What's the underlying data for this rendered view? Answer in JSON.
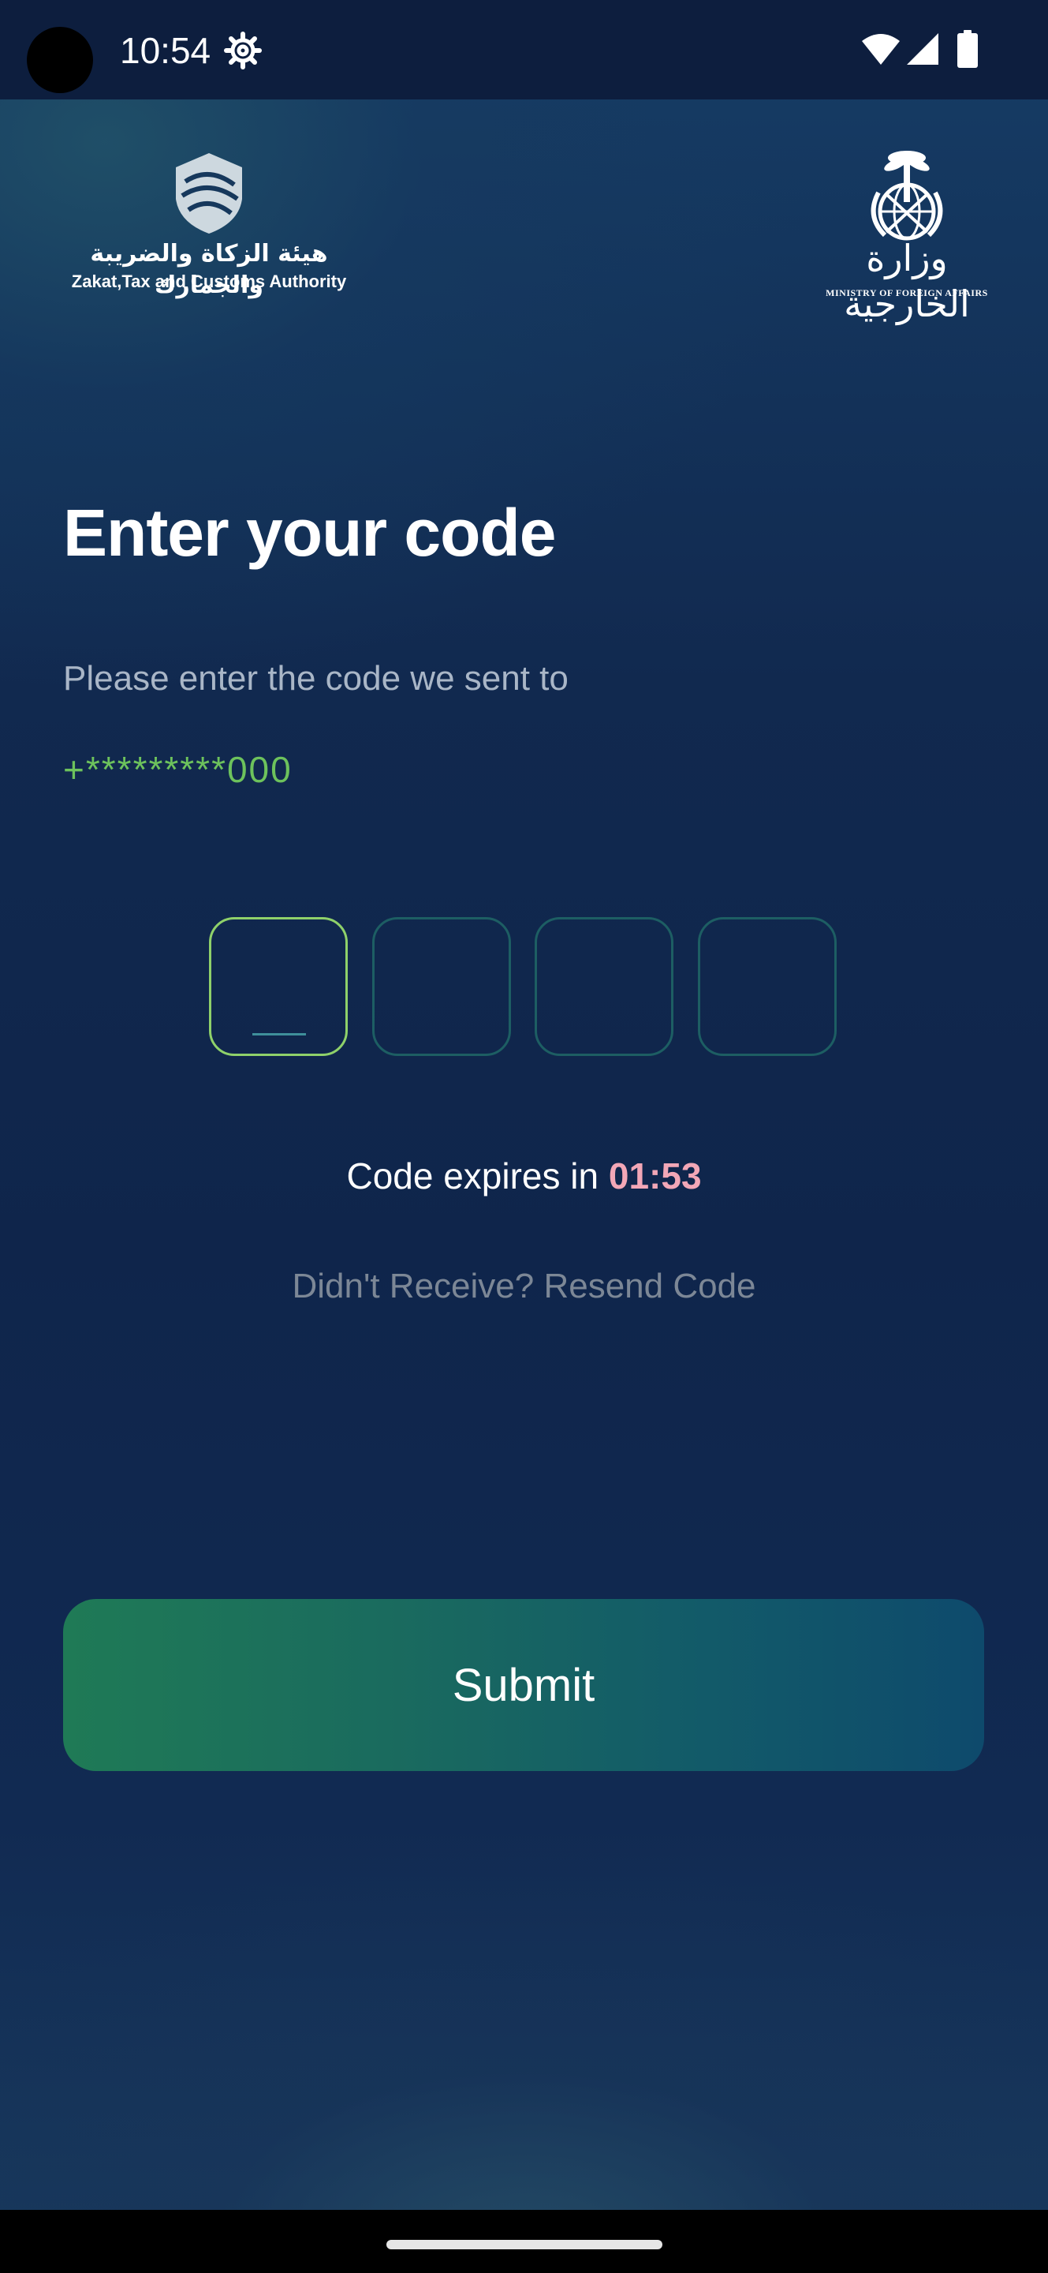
{
  "status_bar": {
    "time": "10:54",
    "icons": [
      "settings-icon",
      "wifi-icon",
      "cell-signal-icon",
      "battery-icon"
    ]
  },
  "logos": {
    "zatca": {
      "arabic": "هيئة الزكاة والضريبة والجمارك",
      "english": "Zakat,Tax and Customs Authority"
    },
    "mofa": {
      "arabic": "وزارة الخارجية",
      "english": "MINISTRY OF FOREIGN AFFAIRS"
    }
  },
  "main": {
    "title": "Enter your code",
    "subtitle": "Please enter the code we sent to",
    "masked_phone": "+*********000",
    "code_inputs": [
      {
        "value": "",
        "active": true
      },
      {
        "value": "",
        "active": false
      },
      {
        "value": "",
        "active": false
      },
      {
        "value": "",
        "active": false
      }
    ],
    "expiry_label": "Code expires in ",
    "expiry_time": "01:53",
    "resend_label": "Didn't Receive? Resend Code",
    "submit_label": "Submit"
  },
  "colors": {
    "background": "#0f254b",
    "accent_green": "#6dc25c",
    "expiry_pink": "#f2a7b7",
    "box_border": "#1d5e63",
    "box_border_active": "#8fd16a"
  }
}
